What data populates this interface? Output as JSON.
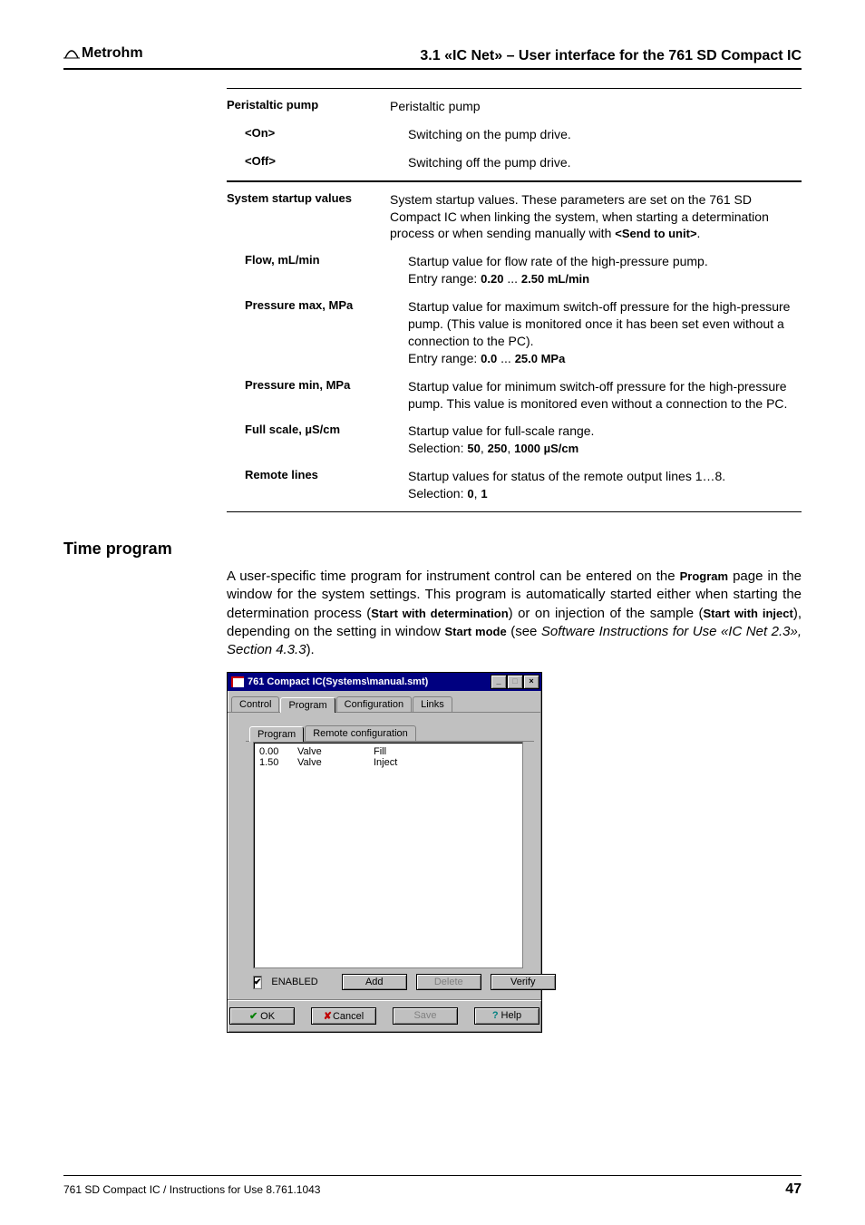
{
  "header": {
    "brand": "Metrohm",
    "section": "3.1  «IC Net» – User interface for the 761 SD Compact IC"
  },
  "definitions": [
    {
      "label": "Peristaltic pump",
      "desc": "Peristaltic pump",
      "ruleTop": true
    },
    {
      "label": "<On>",
      "indent": true,
      "desc": "Switching on the pump drive."
    },
    {
      "label": "<Off>",
      "indent": true,
      "desc": "Switching off the pump drive.",
      "ruleBottom": true
    },
    {
      "label": "System startup values",
      "desc_html": "System startup values. These parameters are set on the 761 SD Compact IC when linking the system, when starting a determination process or when sending manually with <b class='bold'>&lt;Send to unit&gt;</b>.",
      "ruleTop": false
    },
    {
      "label": "Flow, mL/min",
      "indent": true,
      "desc_html": "Startup value for flow rate of the high-pressure pump.<br>Entry range: <b class='bold'>0.20</b> ... <b class='bold'>2.50 mL/min</b>"
    },
    {
      "label": "Pressure max, MPa",
      "indent": true,
      "desc_html": "Startup value for maximum switch-off pressure for the high-pressure pump. (This value is monitored once it has been set even without a connection to the PC).<br>Entry range: <b class='bold'>0.0</b> ... <b class='bold'>25.0 MPa</b>"
    },
    {
      "label": "Pressure min, MPa",
      "indent": true,
      "desc_html": "Startup value for minimum switch-off pressure for the high-pressure pump. This value is monitored even without a connection to the PC."
    },
    {
      "label": "Full scale, µS/cm",
      "indent": true,
      "desc_html": "Startup value for full-scale range.<br>Selection: <b class='bold'>50</b>, <b class='bold'>250</b>, <b class='bold'>1000 µS/cm</b>"
    },
    {
      "label": "Remote lines",
      "indent": true,
      "desc_html": "Startup values for status of the remote output lines 1…8.<br>Selection: <b class='bold'>0</b>, <b class='bold'>1</b>",
      "ruleBottom": true
    }
  ],
  "time_program": {
    "heading": "Time program",
    "para_html": "A user-specific time program for instrument control can be entered on the <b class='bold'>Program</b> page in the window for the system settings. This program is automatically started either when starting the determination process (<b class='bold'>Start with determination</b>) or on injection of the sample (<b class='bold'>Start with inject</b>), depending on the setting in window <b class='bold'>Start mode</b> (see <i class='italic'>Software Instructions for Use «IC Net 2.3», Section 4.3.3</i>)."
  },
  "dialog": {
    "title": "761 Compact IC(Systems\\manual.smt)",
    "outer_tabs": [
      "Control",
      "Program",
      "Configuration",
      "Links"
    ],
    "outer_active": 1,
    "inner_tabs": [
      "Program",
      "Remote configuration"
    ],
    "inner_active": 0,
    "rows": [
      {
        "time": "0.00",
        "cmd": "Valve",
        "arg": "Fill"
      },
      {
        "time": "1.50",
        "cmd": "Valve",
        "arg": "Inject"
      }
    ],
    "enabled_label": "ENABLED",
    "enabled_checked": true,
    "buttons_row": {
      "add": "Add",
      "delete": "Delete",
      "verify": "Verify"
    },
    "footer": {
      "ok": "OK",
      "cancel": "Cancel",
      "save": "Save",
      "help": "Help"
    }
  },
  "footer": {
    "doc": "761 SD Compact IC / Instructions for Use  8.761.1043",
    "page": "47"
  }
}
